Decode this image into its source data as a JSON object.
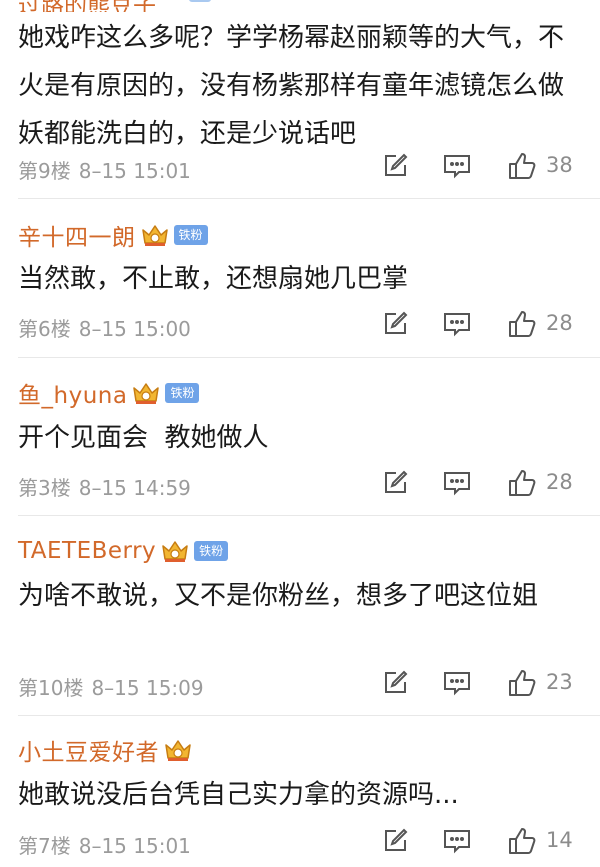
{
  "top_partial_username": "过路的熊豆子",
  "comments": [
    {
      "username": "",
      "text": "她戏咋这么多呢？学学杨幂赵丽颖等的大气，不火是有原因的，没有杨紫那样有童年滤镜怎么做妖都能洗白的，还是少说话吧",
      "floor": "第9楼",
      "time": "8–15 15:01",
      "likes": "38"
    },
    {
      "username": "辛十四一朗",
      "badge": "铁粉",
      "text": "当然敢，不止敢，还想扇她几巴掌",
      "floor": "第6楼",
      "time": "8–15 15:00",
      "likes": "28"
    },
    {
      "username": "鱼_hyuna",
      "badge": "铁粉",
      "text": "开个见面会  教她做人",
      "floor": "第3楼",
      "time": "8–15 14:59",
      "likes": "28"
    },
    {
      "username": "TAETEBerry",
      "badge": "铁粉",
      "text": "为啥不敢说，又不是你粉丝，想多了吧这位姐",
      "floor": "第10楼",
      "time": "8–15 15:09",
      "likes": "23"
    },
    {
      "username": "小土豆爱好者",
      "text": "她敢说没后台凭自己实力拿的资源吗...",
      "floor": "第7楼",
      "time": "8–15 15:01",
      "likes": "14"
    }
  ],
  "colors": {
    "username": "#d2692a",
    "badge_bg": "#6fa3e8",
    "meta": "#9b9b9b",
    "icon": "#555555"
  },
  "icons": {
    "edit": "edit-icon",
    "reply": "comment-icon",
    "like": "thumbs-up-icon",
    "crown": "crown-icon"
  }
}
